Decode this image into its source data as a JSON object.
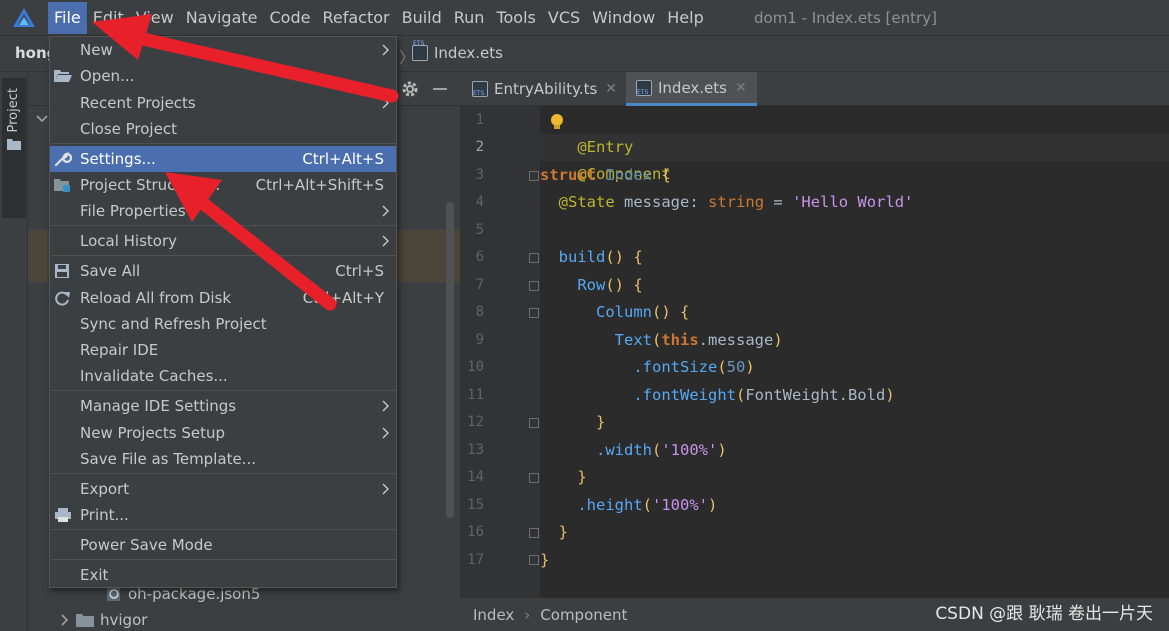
{
  "menubar": {
    "items": [
      {
        "label": "File",
        "active": true
      },
      {
        "label": "Edit"
      },
      {
        "label": "View"
      },
      {
        "label": "Navigate"
      },
      {
        "label": "Code"
      },
      {
        "label": "Refactor"
      },
      {
        "label": "Build"
      },
      {
        "label": "Run"
      },
      {
        "label": "Tools"
      },
      {
        "label": "VCS"
      },
      {
        "label": "Window"
      },
      {
        "label": "Help"
      }
    ],
    "window_title": "dom1 - Index.ets [entry]"
  },
  "navbar": {
    "project": "hong",
    "file": "Index.ets"
  },
  "sidebar": {
    "project_tab": "Project"
  },
  "project_tree": {
    "items": [
      {
        "label": "oh-package.json5"
      },
      {
        "label": "hvigor"
      }
    ]
  },
  "editor": {
    "tabs": [
      {
        "label": "EntryAbility.ts",
        "active": false
      },
      {
        "label": "Index.ets",
        "active": true
      }
    ],
    "line_numbers": [
      "1",
      "2",
      "3",
      "4",
      "5",
      "6",
      "7",
      "8",
      "9",
      "10",
      "11",
      "12",
      "13",
      "14",
      "15",
      "16",
      "17"
    ],
    "code": {
      "l1": "@Entry",
      "l2": "@Component",
      "l3_kw": "struct",
      "l3_name": "Index",
      "l3_brace": "{",
      "l4_ann": "@State",
      "l4_name": "message",
      "l4_colon": ":",
      "l4_type": "string",
      "l4_eq": "=",
      "l4_str": "'Hello World'",
      "l6_fn": "build",
      "l6_rest": "() {",
      "l7_fn": "Row",
      "l7_rest": "() {",
      "l8_fn": "Column",
      "l8_rest": "() {",
      "l9_fn": "Text",
      "l9_open": "(",
      "l9_this": "this",
      "l9_prop": ".message",
      "l9_close": ")",
      "l10_fn": ".fontSize",
      "l10_open": "(",
      "l10_num": "50",
      "l10_close": ")",
      "l11_fn": ".fontWeight",
      "l11_open": "(",
      "l11_arg": "FontWeight.Bold",
      "l11_close": ")",
      "l12": "}",
      "l13_fn": ".width",
      "l13_open": "(",
      "l13_str": "'100%'",
      "l13_close": ")",
      "l14": "}",
      "l15_fn": ".height",
      "l15_open": "(",
      "l15_str": "'100%'",
      "l15_close": ")",
      "l16": "}",
      "l17": "}"
    }
  },
  "breadcrumb": {
    "items": [
      "Index",
      "Component"
    ]
  },
  "watermark": "CSDN @跟 耿瑞 卷出一片天",
  "file_menu": {
    "items": [
      {
        "label": "New",
        "shortcut": "",
        "submenu": true
      },
      {
        "label": "Open...",
        "shortcut": ""
      },
      {
        "label": "Recent Projects",
        "shortcut": "",
        "submenu": true
      },
      {
        "label": "Close Project",
        "shortcut": ""
      },
      {
        "label": "Settings...",
        "shortcut": "Ctrl+Alt+S",
        "selected": true
      },
      {
        "label": "Project Structure...",
        "shortcut": "Ctrl+Alt+Shift+S"
      },
      {
        "label": "File Properties",
        "shortcut": "",
        "submenu": true
      },
      {
        "label": "Local History",
        "shortcut": "",
        "submenu": true
      },
      {
        "label": "Save All",
        "shortcut": "Ctrl+S"
      },
      {
        "label": "Reload All from Disk",
        "shortcut": "Ctrl+Alt+Y"
      },
      {
        "label": "Sync and Refresh Project",
        "shortcut": ""
      },
      {
        "label": "Repair IDE",
        "shortcut": ""
      },
      {
        "label": "Invalidate Caches...",
        "shortcut": ""
      },
      {
        "label": "Manage IDE Settings",
        "shortcut": "",
        "submenu": true
      },
      {
        "label": "New Projects Setup",
        "shortcut": "",
        "submenu": true
      },
      {
        "label": "Save File as Template...",
        "shortcut": ""
      },
      {
        "label": "Export",
        "shortcut": "",
        "submenu": true
      },
      {
        "label": "Print...",
        "shortcut": ""
      },
      {
        "label": "Power Save Mode",
        "shortcut": ""
      },
      {
        "label": "Exit",
        "shortcut": ""
      }
    ]
  },
  "colors": {
    "menu_bg": "#3c3f41",
    "selection": "#4b6eaf",
    "editor_bg": "#2b2b2b",
    "annotation_arrow": "#e8202a"
  }
}
